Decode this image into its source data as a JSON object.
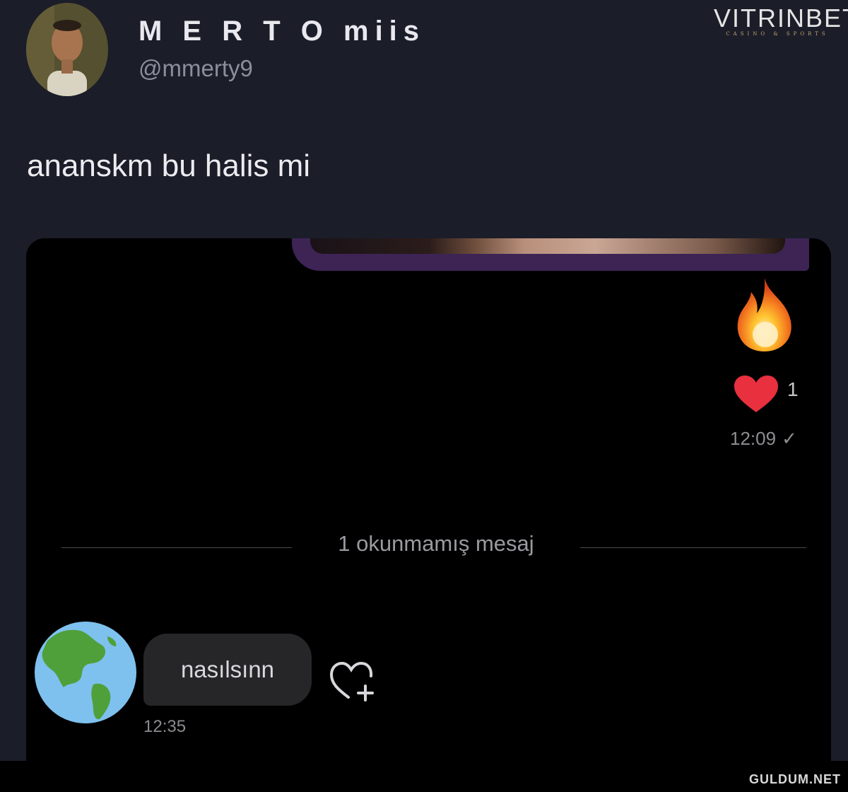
{
  "tweet": {
    "author": {
      "display_name": "M E R T O miis",
      "handle": "@mmerty9",
      "avatar_icon": "profile-photo"
    },
    "text": "ananskm bu halis mi"
  },
  "brand": {
    "name": "VITRINBET",
    "tagline": "CASINO & SPORTS"
  },
  "dm": {
    "sent_message": {
      "reaction_emoji": "🔥",
      "like_icon": "heart-icon",
      "like_count": "1",
      "time": "12:09",
      "status_icon": "checkmark-icon"
    },
    "unread_divider": "1 okunmamış mesaj",
    "received_message": {
      "avatar_icon": "globe-americas-icon",
      "text": "nasılsınn",
      "time": "12:35",
      "action_icon": "add-like-icon"
    }
  },
  "footer": {
    "watermark": "GULDUM.NET"
  },
  "colors": {
    "background": "#1b1d29",
    "dm_background": "#000000",
    "shared_bubble": "#3d2455",
    "like_red": "#e8303f",
    "received_bubble": "#262628"
  }
}
